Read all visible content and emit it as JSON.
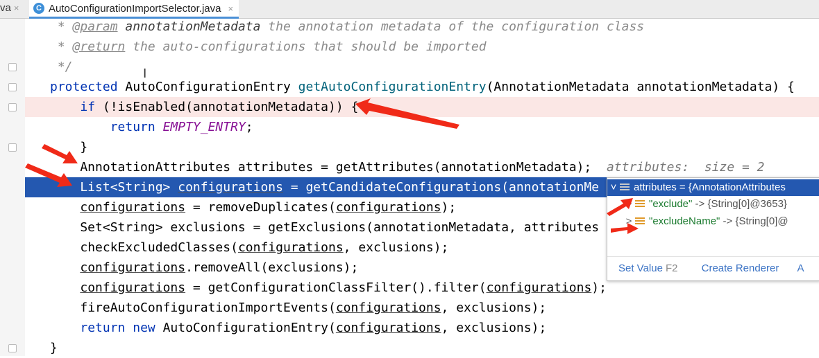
{
  "tabs": {
    "prev_label": "va",
    "active_icon": "C",
    "active_label": "AutoConfigurationImportSelector.java",
    "close_glyph": "×"
  },
  "code": {
    "l1_prefix": " * ",
    "l1_tag": "@param",
    "l1_name": " annotationMetadata",
    "l1_rest": " the annotation metadata of the configuration class",
    "l2_prefix": " * ",
    "l2_tag": "@return",
    "l2_rest": " the auto-configurations that should be imported",
    "l3": " */",
    "l4_kw": "protected",
    "l4_type": " AutoConfigurationEntry ",
    "l4_fn": "getAutoConfigurationEntry",
    "l4_rest": "(AnnotationMetadata annotationMetadata) {",
    "l5_ind": "    ",
    "l5_kw": "if",
    "l5_rest": " (!isEnabled(annotationMetadata)) {",
    "l6_ind": "        ",
    "l6_kw": "return",
    "l6_sp": " ",
    "l6_const": "EMPTY_ENTRY",
    "l6_end": ";",
    "l7": "    }",
    "l8_code": "    AnnotationAttributes attributes = getAttributes(annotationMetadata);",
    "l8_hint": "  attributes:  size = 2",
    "l9_a": "    List<String> ",
    "l9_var": "configurations",
    "l9_b": " = getCandidateConfigurations(annotationMe",
    "l10_ind": "    ",
    "l10_var": "configurations",
    "l10_mid": " = removeDuplicates(",
    "l10_var2": "configurations",
    "l10_end": ");",
    "l11": "    Set<String> exclusions = getExclusions(annotationMetadata, attributes",
    "l12_ind": "    ",
    "l12_a": "checkExcludedClasses(",
    "l12_var": "configurations",
    "l12_end": ", exclusions);",
    "l13_ind": "    ",
    "l13_var": "configurations",
    "l13_end": ".removeAll(exclusions);",
    "l14_ind": "    ",
    "l14_var": "configurations",
    "l14_mid": " = getConfigurationClassFilter().filter(",
    "l14_var2": "configurations",
    "l14_end": ");",
    "l15_ind": "    ",
    "l15_a": "fireAutoConfigurationImportEvents(",
    "l15_var": "configurations",
    "l15_end": ", exclusions);",
    "l16_ind": "    ",
    "l16_kw1": "return",
    "l16_sp": " ",
    "l16_kw2": "new",
    "l16_a": " AutoConfigurationEntry(",
    "l16_var": "configurations",
    "l16_end": ", exclusions);",
    "l17": "}"
  },
  "popup": {
    "root_chevron": "˅",
    "root_label": "attributes = {AnnotationAttributes",
    "child_chevron": ">",
    "items": [
      {
        "key": "\"exclude\"",
        "arrow": " -> ",
        "value": "{String[0]@3653}"
      },
      {
        "key": "\"excludeName\"",
        "arrow": " -> ",
        "value": "{String[0]@"
      }
    ],
    "footer": {
      "set_value": "Set Value",
      "set_value_key": "F2",
      "create_renderer": "Create Renderer",
      "more": "A"
    }
  },
  "colors": {
    "selection": "#2458b0",
    "error_line": "#fbe7e5",
    "annotation_arrow": "#f02a18"
  }
}
